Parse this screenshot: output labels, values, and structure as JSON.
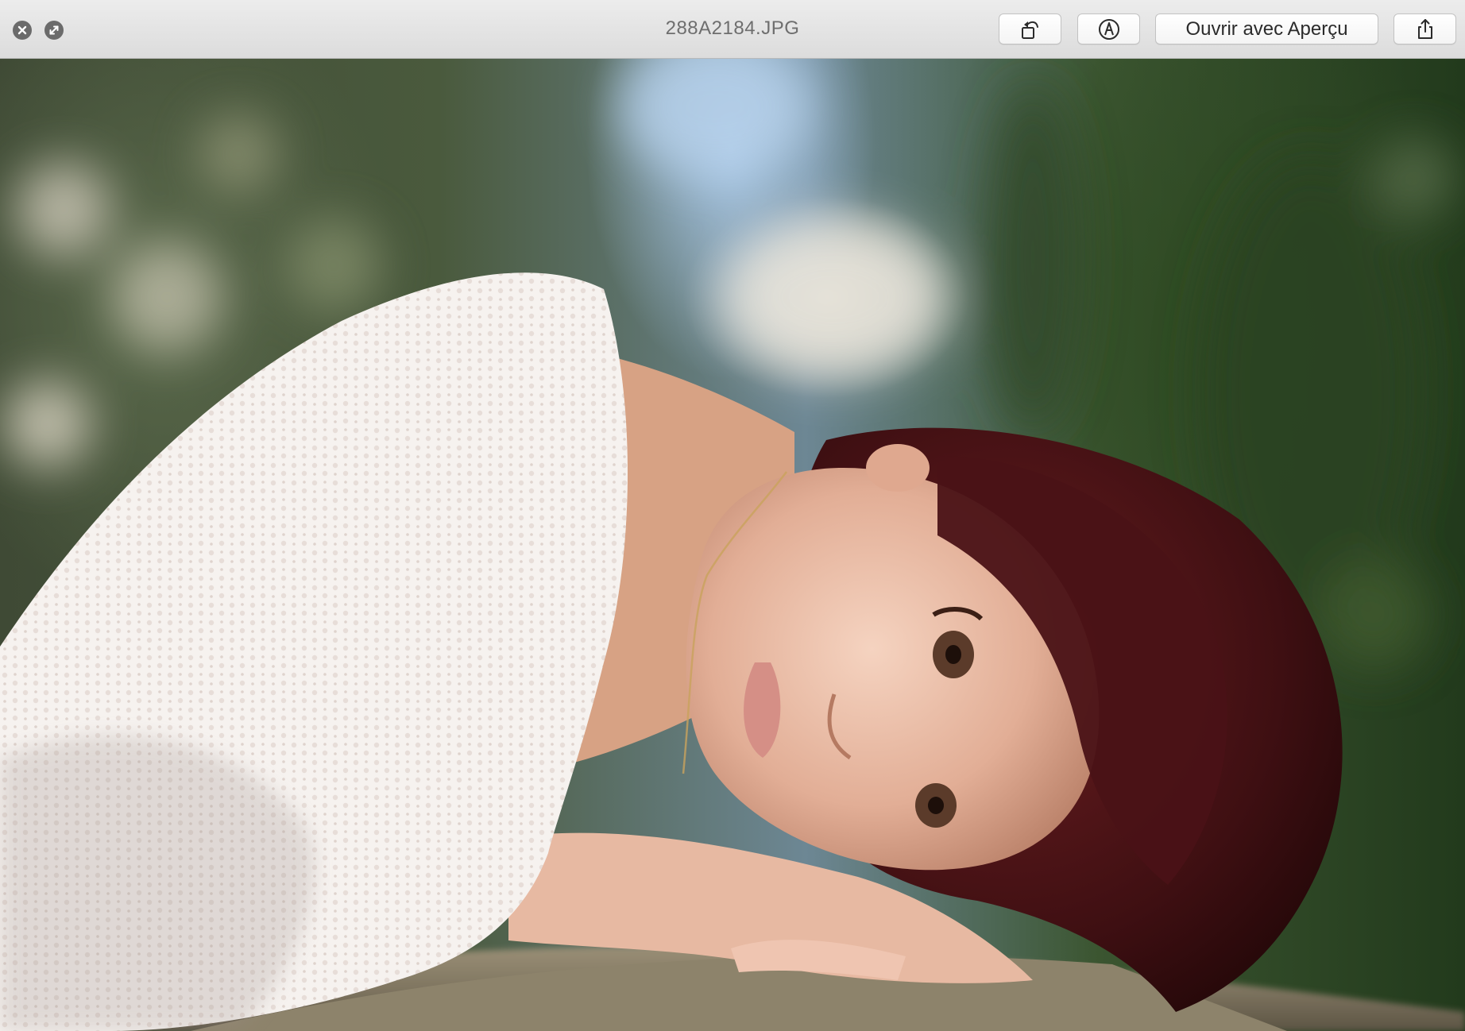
{
  "window": {
    "title": "288A2184.JPG"
  },
  "toolbar": {
    "close_icon": "close-icon",
    "fullscreen_icon": "fullscreen-icon",
    "rotate_icon": "rotate-left-icon",
    "markup_icon": "markup-pen-icon",
    "open_with_label": "Ouvrir avec Aperçu",
    "share_icon": "share-icon"
  },
  "photo": {
    "subject": "photo-portrait"
  },
  "colors": {
    "toolbar_bg": "#e3e3e3",
    "title_text": "#6e6e6e",
    "control_gray": "#6b6b6b"
  }
}
